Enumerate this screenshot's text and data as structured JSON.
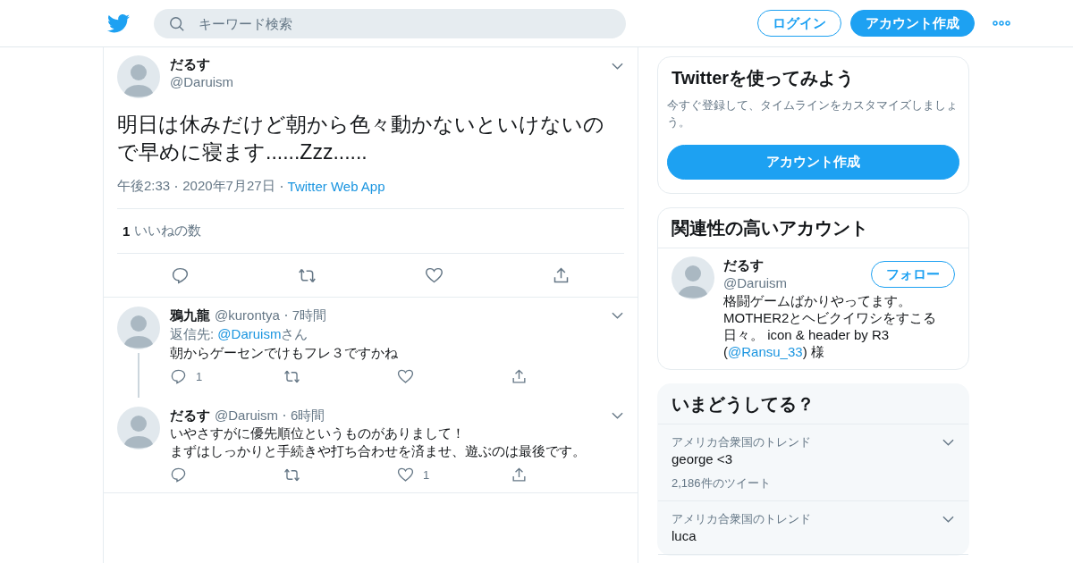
{
  "header": {
    "search": {
      "placeholder": "キーワード検索"
    },
    "login": "ログイン",
    "signup": "アカウント作成"
  },
  "tweet": {
    "name": "だるす",
    "handle": "@Daruism",
    "text": "明日は休みだけど朝から色々動かないといけないので早めに寝ます......Zzz......",
    "time": "午後2:33",
    "date": "2020年7月27日",
    "source": "Twitter Web App",
    "like_count": "1",
    "like_label": "いいねの数"
  },
  "replies": [
    {
      "name": "鴉九龍",
      "handle": "@kurontya",
      "time": "7時間",
      "reply_to": {
        "prefix": "返信先:",
        "handle": "@Daruism",
        "suffix": "さん"
      },
      "lines": [
        "朝からゲーセンでけもフレ３ですかね"
      ],
      "reply_count": "1",
      "thread_line": true
    },
    {
      "name": "だるす",
      "handle": "@Daruism",
      "time": "6時間",
      "lines": [
        "いやさすがに優先順位というものがありまして！",
        "まずはしっかりと手続きや打ち合わせを済ませ、遊ぶのは最後です。"
      ],
      "like_count": "1",
      "thread_line": false
    }
  ],
  "signup_card": {
    "title": "Twitterを使ってみよう",
    "text": "今すぐ登録して、タイムラインをカスタマイズしましょう。",
    "button": "アカウント作成"
  },
  "related": {
    "title": "関連性の高いアカウント",
    "account": {
      "name": "だるす",
      "handle": "@Daruism",
      "follow": "フォロー",
      "bio_before": "格闘ゲームばかりやってます。MOTHER2とヘビクイワシをすこる日々。 icon & header by R3 (",
      "bio_link": "@Ransu_33",
      "bio_after": ") 様"
    }
  },
  "trends": {
    "title": "いまどうしてる？",
    "items": [
      {
        "context": "アメリカ合衆国のトレンド",
        "name": "george <3",
        "count": "2,186件のツイート"
      },
      {
        "context": "アメリカ合衆国のトレンド",
        "name": "luca"
      }
    ]
  }
}
